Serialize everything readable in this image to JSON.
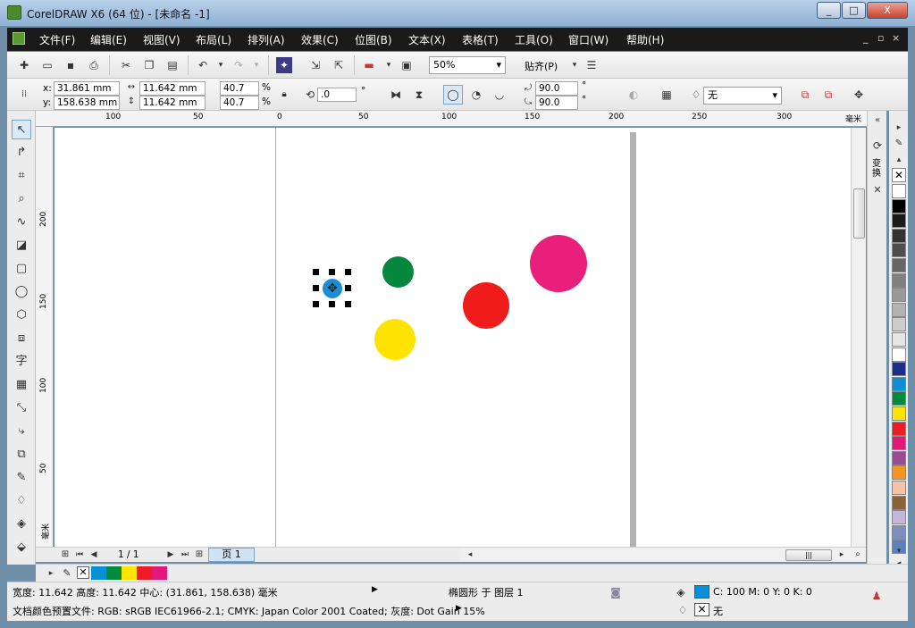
{
  "window": {
    "title": "CorelDRAW X6 (64 位) - [未命名 -1]",
    "min": "_",
    "max": "□",
    "close": "X"
  },
  "menu": {
    "items": [
      "文件(F)",
      "编辑(E)",
      "视图(V)",
      "布局(L)",
      "排列(A)",
      "效果(C)",
      "位图(B)",
      "文本(X)",
      "表格(T)",
      "工具(O)",
      "窗口(W)",
      "帮助(H)"
    ],
    "mdi": [
      "_",
      "▫",
      "×"
    ]
  },
  "standard": {
    "zoom": "50%",
    "snap": "贴齐(P)"
  },
  "property": {
    "x_label": "x:",
    "x": "31.861 mm",
    "y_label": "y:",
    "y": "158.638 mm",
    "w": "11.642 mm",
    "h": "11.642 mm",
    "sx": "40.7",
    "sy": "40.7",
    "pct": "%",
    "rotate": ".0",
    "deg": "°",
    "start_angle": "90.0",
    "end_angle": "90.0",
    "outline": "无"
  },
  "rulers": {
    "h_ticks": [
      "100",
      "50",
      "0",
      "50",
      "100",
      "150",
      "200",
      "250",
      "300"
    ],
    "h_unit": "毫米",
    "v_ticks": [
      "200",
      "150",
      "100",
      "50"
    ],
    "v_unit": "毫米"
  },
  "page": {
    "indicator": "1 / 1",
    "tab": "页 1"
  },
  "docker": {
    "label": "变换"
  },
  "palette_colors": [
    "#ffffff",
    "#000000",
    "#1a1a1a",
    "#333333",
    "#4d4d4d",
    "#666666",
    "#808080",
    "#999999",
    "#b3b3b3",
    "#cccccc",
    "#e6e6e6",
    "#ffffff",
    "#1d2d8c",
    "#0a8fd6",
    "#008c3c",
    "#ffe400",
    "#ee1c25",
    "#e4187a",
    "#9b4a96",
    "#f7931e",
    "#f5c2a6",
    "#8c6239",
    "#c4b5d9",
    "#7d8ec2",
    "#5a7fc2"
  ],
  "doc_palette": [
    "#0a8fd6",
    "#008c3c",
    "#ffe400",
    "#ee1c25",
    "#e4187a"
  ],
  "shapes": [
    {
      "name": "selected-blue-circle",
      "color": "#1b8ed6"
    },
    {
      "name": "green-circle",
      "color": "#05873d"
    },
    {
      "name": "yellow-circle",
      "color": "#ffe300"
    },
    {
      "name": "red-circle",
      "color": "#f01b1b"
    },
    {
      "name": "magenta-circle",
      "color": "#e8207c"
    }
  ],
  "status": {
    "line1": "宽度: 11.642  高度: 11.642  中心: (31.861, 158.638)  毫米",
    "layer": "椭圆形 于 图层 1",
    "fill_info": "C: 100 M: 0 Y: 0 K: 0",
    "line2": "文档颜色预置文件: RGB: sRGB IEC61966-2.1; CMYK: Japan Color 2001 Coated; 灰度: Dot Gain 15%",
    "outline": "无",
    "fill_color": "#0a8fd6"
  }
}
